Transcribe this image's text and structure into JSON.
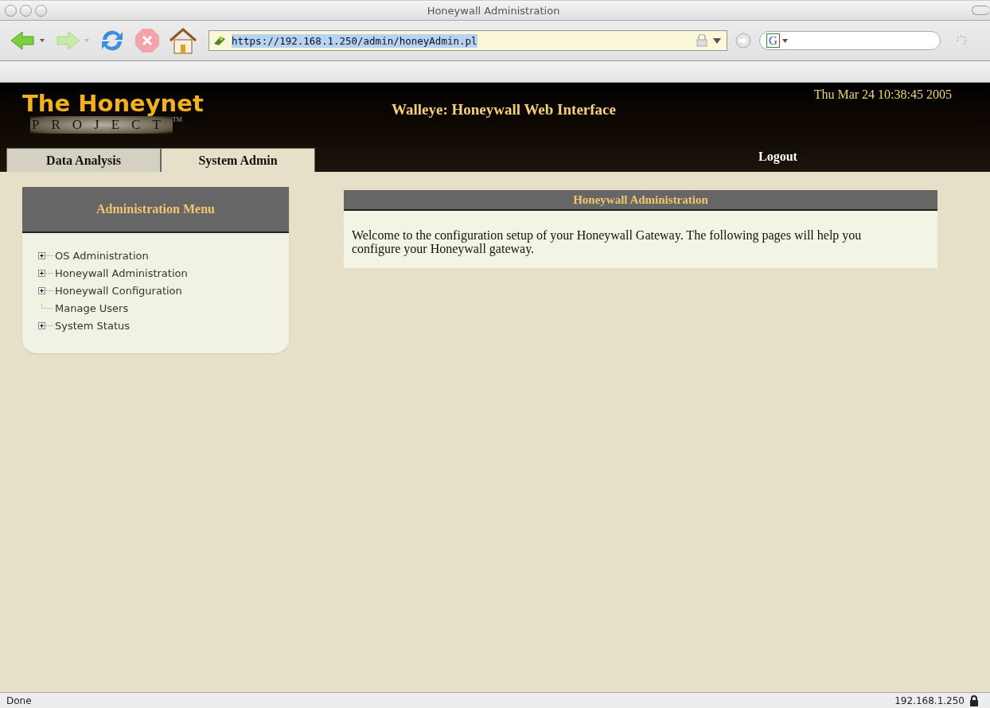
{
  "window": {
    "title": "Honeywall Administration"
  },
  "browser": {
    "url": "https://192.168.1.250/admin/honeyAdmin.pl",
    "search_engine_glyph": "G"
  },
  "header": {
    "logo_title": "The Honeynet",
    "logo_subtitle": "PROJECT",
    "logo_mark": "TM",
    "title": "Walleye: Honeywall Web Interface",
    "datetime": "Thu Mar 24 10:38:45 2005"
  },
  "tabs": [
    {
      "label": "Data Analysis",
      "selected": false
    },
    {
      "label": "System Admin",
      "selected": true
    }
  ],
  "logout": "Logout",
  "menu": {
    "title": "Administration Menu",
    "items": [
      {
        "label": "OS Administration",
        "expandable": true
      },
      {
        "label": "Honeywall Administration",
        "expandable": true
      },
      {
        "label": "Honeywall Configuration",
        "expandable": true
      },
      {
        "label": "Manage Users",
        "expandable": false
      },
      {
        "label": "System Status",
        "expandable": true
      }
    ]
  },
  "panel": {
    "title": "Honeywall Administration",
    "text": "Welcome to the configuration setup of your Honeywall Gateway. The following pages will help you configure your Honeywall gateway."
  },
  "status_bar": {
    "text": "Done",
    "host": "192.168.1.250"
  }
}
